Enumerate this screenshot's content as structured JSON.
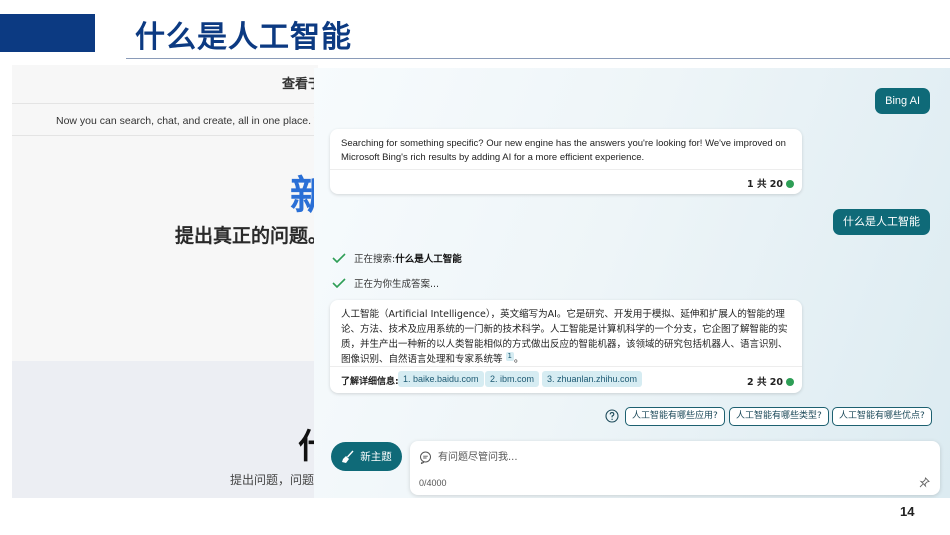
{
  "slide": {
    "title": "什么是人工智能",
    "page_number": "14"
  },
  "background_page": {
    "top_label": "查看于",
    "subtitle": "Now you can search, chat, and create, all in one place. Turn y",
    "big_text": "新",
    "heading": "提出真正的问题。",
    "big_text_2": "什",
    "caption": "提出问题，问题"
  },
  "chat": {
    "bing_pill": "Bing AI",
    "first_reply": {
      "text": "Searching for something specific? Our new engine has the answers you're looking for! We've improved on Microsoft Bing's rich results by adding AI for a more efficient experience.",
      "counter": "1 共 20"
    },
    "user_question": "什么是人工智能",
    "status_searching_prefix": "正在搜索: ",
    "status_searching_term": "什么是人工智能",
    "status_generating": "正在为你生成答案...",
    "answer": {
      "text": "人工智能（Artificial Intelligence），英文缩写为AI。它是研究、开发用于模拟、延伸和扩展人的智能的理论、方法、技术及应用系统的一门新的技术科学。人工智能是计算机科学的一个分支，它企图了解智能的实质，并生产出一种新的以人类智能相似的方式做出反应的智能机器，该领域的研究包括机器人、语言识别、图像识别、自然语言处理和专家系统等",
      "footnote": "1",
      "end_mark": "。",
      "learn_more_label": "了解详细信息:",
      "sources": [
        "1. baike.baidu.com",
        "2. ibm.com",
        "3. zhuanlan.zhihu.com"
      ],
      "counter": "2 共 20"
    },
    "suggestions": [
      "人工智能有哪些应用?",
      "人工智能有哪些类型?",
      "人工智能有哪些优点?"
    ],
    "new_topic_label": "新主题",
    "input_placeholder": "有问题尽管问我...",
    "char_count": "0/4000"
  },
  "colors": {
    "brand_blue": "#0c3a82",
    "teal": "#0f6a78",
    "status_green": "#2e9e56"
  },
  "icons": [
    "check-icon",
    "question-circle-icon",
    "broom-icon",
    "chat-bubble-icon",
    "pin-icon"
  ]
}
